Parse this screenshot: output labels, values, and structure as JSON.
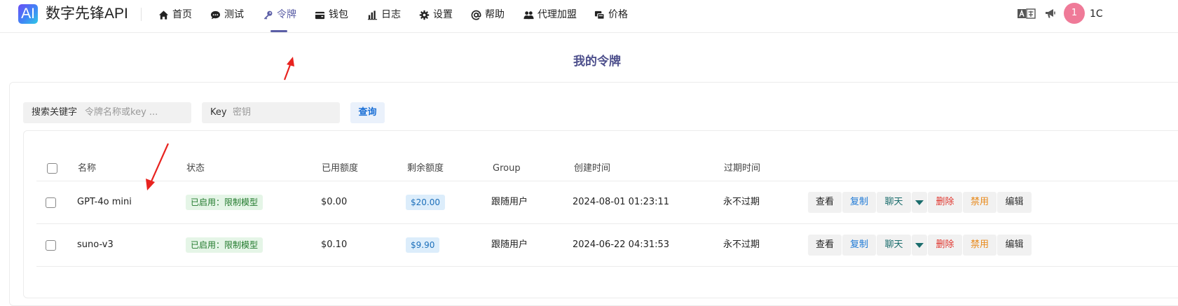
{
  "brand": {
    "logo_text": "AI",
    "name": "数字先锋API"
  },
  "nav": {
    "items": [
      {
        "label": "首页",
        "icon": "home-icon"
      },
      {
        "label": "测试",
        "icon": "chat-bubble-icon"
      },
      {
        "label": "令牌",
        "icon": "key-icon",
        "active": true
      },
      {
        "label": "钱包",
        "icon": "wallet-icon"
      },
      {
        "label": "日志",
        "icon": "bar-chart-icon"
      },
      {
        "label": "设置",
        "icon": "gear-icon"
      },
      {
        "label": "帮助",
        "icon": "at-sign-icon"
      },
      {
        "label": "代理加盟",
        "icon": "users-icon"
      },
      {
        "label": "价格",
        "icon": "price-tag-icon"
      }
    ]
  },
  "header_right": {
    "language_icon": "translate-icon",
    "announce_icon": "megaphone-icon",
    "avatar_text": "1",
    "user_truncated": "1C"
  },
  "page": {
    "title": "我的令牌"
  },
  "search": {
    "keyword_prefix": "搜索关键字",
    "keyword_placeholder": "令牌名称或key ...",
    "key_prefix": "Key",
    "key_placeholder": "密钥",
    "query_label": "查询"
  },
  "table": {
    "headers": {
      "name": "名称",
      "status": "状态",
      "used": "已用额度",
      "remaining": "剩余额度",
      "group": "Group",
      "created": "创建时间",
      "expires": "过期时间"
    },
    "actions": {
      "view": "查看",
      "copy": "复制",
      "chat": "聊天",
      "delete": "删除",
      "disable": "禁用",
      "edit": "编辑"
    },
    "rows": [
      {
        "name": "GPT-4o mini",
        "status": "已启用：限制模型",
        "used": "$0.00",
        "remaining": "$20.00",
        "group": "跟随用户",
        "created": "2024-08-01 01:23:11",
        "expires": "永不过期"
      },
      {
        "name": "suno-v3",
        "status": "已启用：限制模型",
        "used": "$0.10",
        "remaining": "$9.90",
        "group": "跟随用户",
        "created": "2024-06-22 04:31:53",
        "expires": "永不过期"
      }
    ]
  },
  "colors": {
    "accent": "#5b5ea6",
    "annotation_arrow": "#e8231f",
    "status_green_bg": "#e5f5e7",
    "remain_blue_bg": "#dcedfb"
  }
}
